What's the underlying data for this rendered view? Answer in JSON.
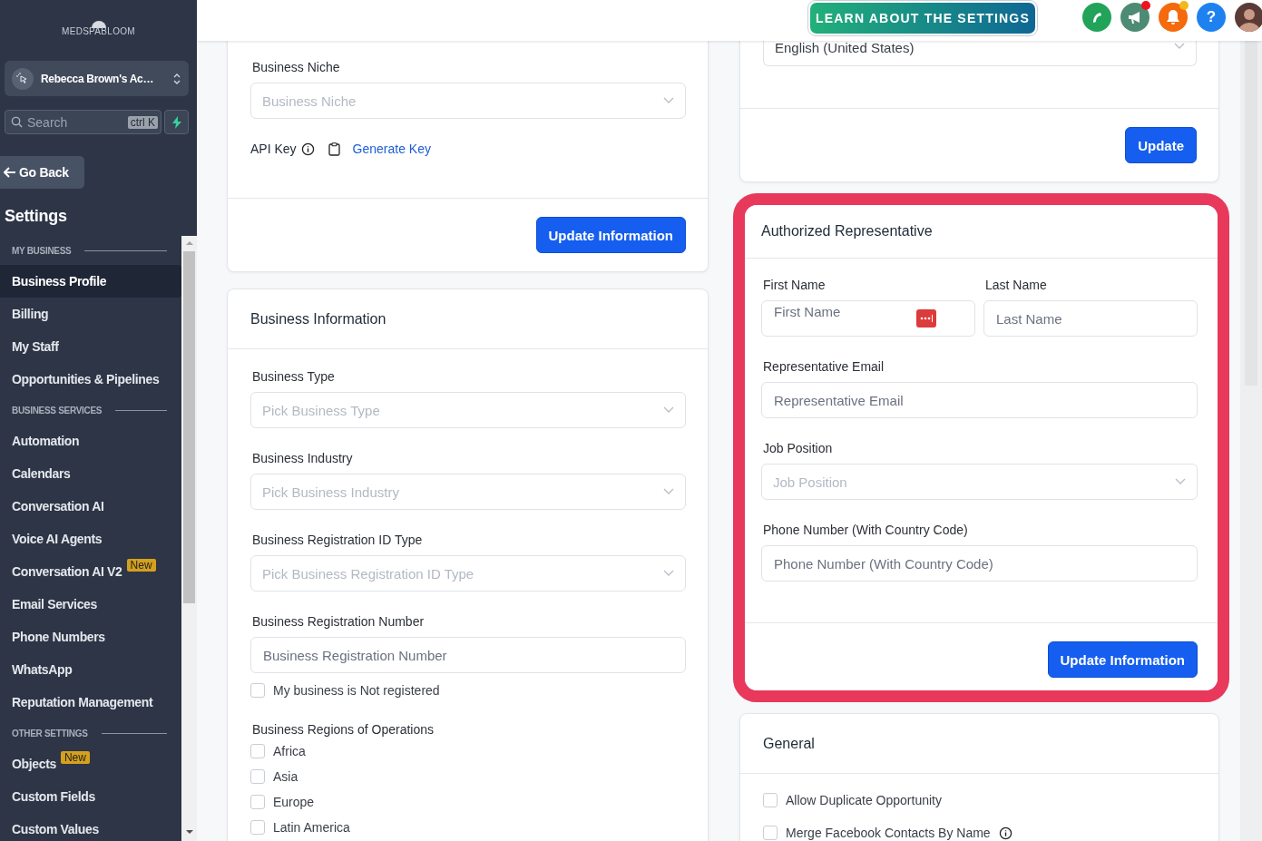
{
  "sidebar": {
    "logo": "MEDSPABLOOM",
    "account": "Rebecca Brown's Ac…",
    "search": {
      "placeholder": "Search",
      "shortcut": "ctrl K"
    },
    "back": "Go Back",
    "title": "Settings",
    "sections": [
      {
        "heading": "MY BUSINESS",
        "items": [
          {
            "label": "Business Profile",
            "selected": true
          },
          {
            "label": "Billing",
            "selected": false
          },
          {
            "label": "My Staff",
            "selected": false
          },
          {
            "label": "Opportunities & Pipelines",
            "selected": false
          }
        ]
      },
      {
        "heading": "BUSINESS SERVICES",
        "items": [
          {
            "label": "Automation",
            "selected": false
          },
          {
            "label": "Calendars",
            "selected": false
          },
          {
            "label": "Conversation AI",
            "selected": false
          },
          {
            "label": "Voice AI Agents",
            "selected": false
          },
          {
            "label": "Conversation AI V2",
            "badge": "New",
            "selected": false
          },
          {
            "label": "Email Services",
            "selected": false
          },
          {
            "label": "Phone Numbers",
            "selected": false
          },
          {
            "label": "WhatsApp",
            "selected": false
          },
          {
            "label": "Reputation Management",
            "selected": false
          }
        ]
      },
      {
        "heading": "OTHER SETTINGS",
        "items": [
          {
            "label": "Objects",
            "badge": "New",
            "selected": false
          },
          {
            "label": "Custom Fields",
            "selected": false
          },
          {
            "label": "Custom Values",
            "selected": false
          }
        ]
      }
    ]
  },
  "header": {
    "learn_button": "LEARN ABOUT THE SETTINGS",
    "help": "?"
  },
  "columns": [
    [
      {
        "cut_top": true,
        "fields": [
          {
            "kind": "select",
            "label": "Business Niche",
            "placeholder": "Business Niche"
          },
          {
            "kind": "api_key",
            "label": "API Key",
            "link": "Generate Key"
          }
        ],
        "button": "Update Information"
      },
      {
        "title": "Business Information",
        "fields": [
          {
            "kind": "select",
            "label": "Business Type",
            "placeholder": "Pick Business Type"
          },
          {
            "kind": "select",
            "label": "Business Industry",
            "placeholder": "Pick Business Industry"
          },
          {
            "kind": "select",
            "label": "Business Registration ID Type",
            "placeholder": "Pick Business Registration ID Type"
          },
          {
            "kind": "input",
            "label": "Business Registration Number",
            "placeholder": "Business Registration Number"
          },
          {
            "kind": "checkbox",
            "label": "My business is Not registered",
            "checked": false
          },
          {
            "kind": "checkbox_group",
            "label": "Business Regions of Operations",
            "options": [
              {
                "label": "Africa",
                "checked": false
              },
              {
                "label": "Asia",
                "checked": false
              },
              {
                "label": "Europe",
                "checked": false
              },
              {
                "label": "Latin America",
                "checked": false
              }
            ]
          }
        ]
      }
    ],
    [
      {
        "cut_top": true,
        "fields": [
          {
            "kind": "select",
            "value": "English (United States)"
          }
        ],
        "button": "Update"
      },
      {
        "title": "Authorized Representative",
        "highlighted": true,
        "fields": [
          {
            "kind": "input_pair",
            "inputs": [
              {
                "label": "First Name",
                "placeholder": "First Name",
                "autofill": true
              },
              {
                "label": "Last Name",
                "placeholder": "Last Name",
                "autofill": false
              }
            ]
          },
          {
            "kind": "input",
            "label": "Representative Email",
            "placeholder": "Representative Email"
          },
          {
            "kind": "select",
            "label": "Job Position",
            "placeholder": "Job Position"
          },
          {
            "kind": "input",
            "label": "Phone Number (With Country Code)",
            "placeholder": "Phone Number (With Country Code)"
          }
        ],
        "button": "Update Information"
      },
      {
        "title": "General",
        "fields": [
          {
            "kind": "checkbox",
            "label": "Allow Duplicate Opportunity",
            "checked": false,
            "info": false
          },
          {
            "kind": "checkbox",
            "label": "Merge Facebook Contacts By Name",
            "checked": false,
            "info": true
          }
        ]
      }
    ]
  ]
}
